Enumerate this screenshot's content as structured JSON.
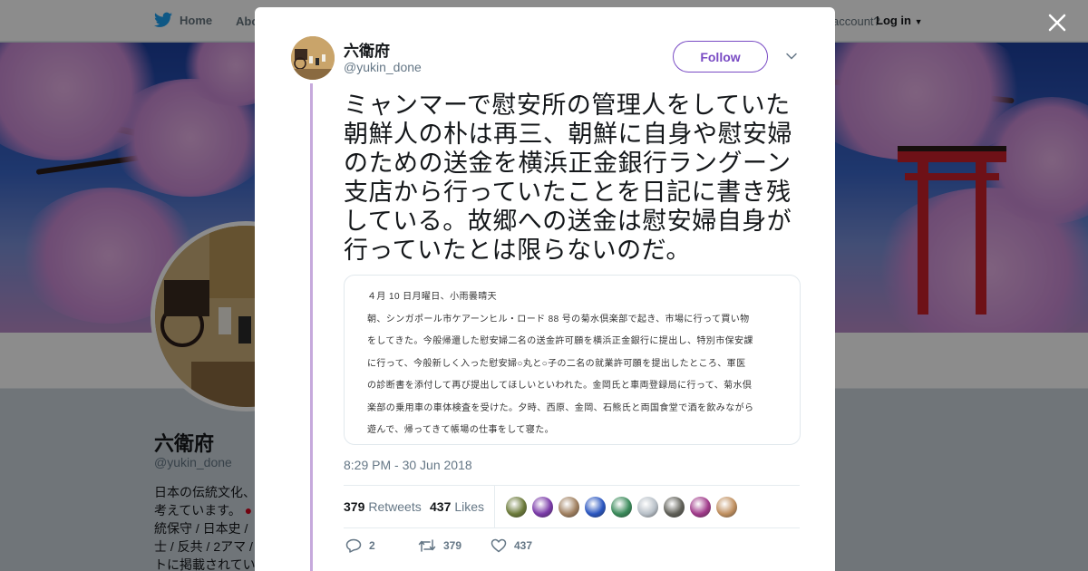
{
  "nav": {
    "home_label": "Home",
    "about_label": "Abo",
    "account_prompt": "account?",
    "login_label": "Log in"
  },
  "profile": {
    "name": "六衛府",
    "handle": "@yukin_done",
    "bio_lines": [
      "日本の伝統文化、",
      "考えています。",
      "統保守 / 日本史 /",
      "士 / 反共 / 2アマ /",
      "トに掲載されてい"
    ]
  },
  "tweet": {
    "author_name": "六衛府",
    "author_handle": "@yukin_done",
    "follow_label": "Follow",
    "text": "ミャンマーで慰安所の管理人をしていた朝鮮人の朴は再三、朝鮮に自身や慰安婦のための送金を横浜正金銀行ラングーン支店から行っていたことを日記に書き残している。故郷への送金は慰安婦自身が行っていたとは限らないのだ。",
    "media_lines": [
      "４月 10 日月曜日、小雨曇晴天",
      "朝、シンガポール市ケアーンヒル・ロード 88 号の菊水倶楽部で起き、市場に行って買い物",
      "をしてきた。今般帰還した慰安婦二名の送金許可願を横浜正金銀行に提出し、特別市保安課",
      "に行って、今般新しく入った慰安婦○丸と○子の二名の就業許可願を提出したところ、軍医",
      "の診断書を添付して再び提出してほしいといわれた。金岡氏と車両登録局に行って、菊水倶",
      "楽部の乗用車の車体検査を受けた。夕時、西原、金岡、石熊氏と両国食堂で酒を飲みながら",
      "遊んで、帰ってきて帳場の仕事をして寝た。"
    ],
    "timestamp": "8:29 PM - 30 Jun 2018",
    "retweets_count": "379",
    "retweets_label": "Retweets",
    "likes_count": "437",
    "likes_label": "Likes",
    "likers": [
      "#6b7a3a",
      "#7a3aa8",
      "#a08060",
      "#2a56c0",
      "#3a8a5a",
      "#b8c0c8",
      "#606058",
      "#a03a8a",
      "#c09060"
    ],
    "reply_count": "2",
    "retweet_action_count": "379",
    "like_action_count": "437"
  },
  "colors": {
    "accent": "#794bc4",
    "thread_line": "#c6a9dc",
    "secondary_text": "#657786"
  }
}
